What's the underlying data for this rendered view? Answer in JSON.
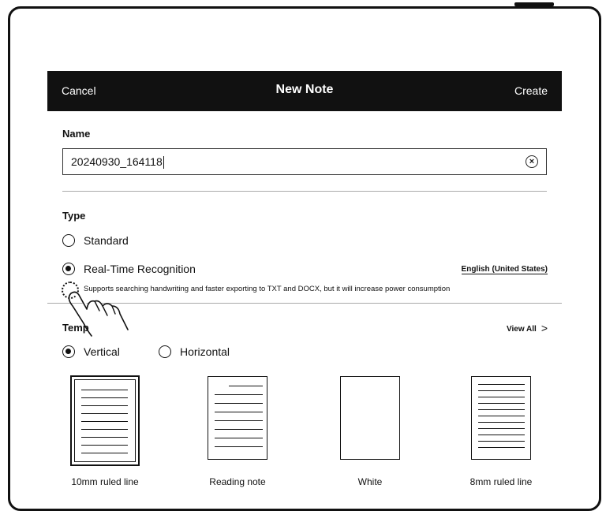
{
  "dialog": {
    "cancel_label": "Cancel",
    "title": "New Note",
    "create_label": "Create"
  },
  "name_section": {
    "label": "Name",
    "value": "20240930_164118"
  },
  "type_section": {
    "label": "Type",
    "option_standard": "Standard",
    "option_realtime": "Real-Time Recognition",
    "selected": "Real-Time Recognition",
    "language": "English (United States)",
    "hint": "Supports searching handwriting and faster exporting to TXT and DOCX, but it will increase power consumption"
  },
  "template_section": {
    "label": "Template",
    "label_visible": "Temp",
    "view_all_label": "View All",
    "orientation_vertical": "Vertical",
    "orientation_horizontal": "Horizontal",
    "selected_orientation": "Vertical",
    "templates": [
      {
        "name": "10mm ruled line",
        "selected": true
      },
      {
        "name": "Reading note",
        "selected": false
      },
      {
        "name": "White",
        "selected": false
      },
      {
        "name": "8mm ruled line",
        "selected": false
      }
    ]
  },
  "icons": {
    "clear": "clear-circle-x-icon",
    "view_all": "chevron-right-icon",
    "hand": "tap-gesture-hand-icon"
  }
}
